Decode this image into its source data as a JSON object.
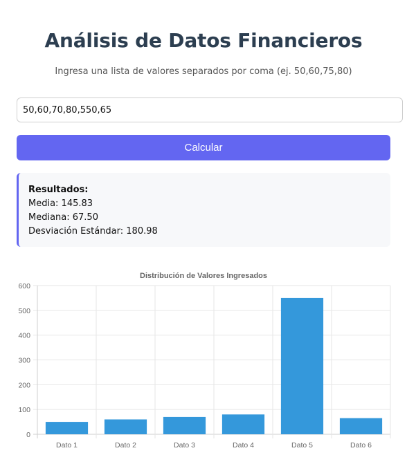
{
  "header": {
    "title": "Análisis de Datos Financieros",
    "instructions": "Ingresa una lista de valores separados por coma (ej. 50,60,75,80)"
  },
  "form": {
    "input_value": "50,60,70,80,550,65",
    "button_label": "Calcular"
  },
  "results": {
    "heading": "Resultados:",
    "mean": "Media: 145.83",
    "median": "Mediana: 67.50",
    "stddev": "Desviación Estándar: 180.98"
  },
  "colors": {
    "accent": "#6366f1",
    "bar": "#3498db",
    "title": "#2c3e50"
  },
  "chart_data": {
    "type": "bar",
    "title": "Distribución de Valores Ingresados",
    "categories": [
      "Dato 1",
      "Dato 2",
      "Dato 3",
      "Dato 4",
      "Dato 5",
      "Dato 6"
    ],
    "values": [
      50,
      60,
      70,
      80,
      550,
      65
    ],
    "ylim": [
      0,
      600
    ],
    "yticks": [
      0,
      100,
      200,
      300,
      400,
      500,
      600
    ],
    "grid": true,
    "legend": "none"
  }
}
